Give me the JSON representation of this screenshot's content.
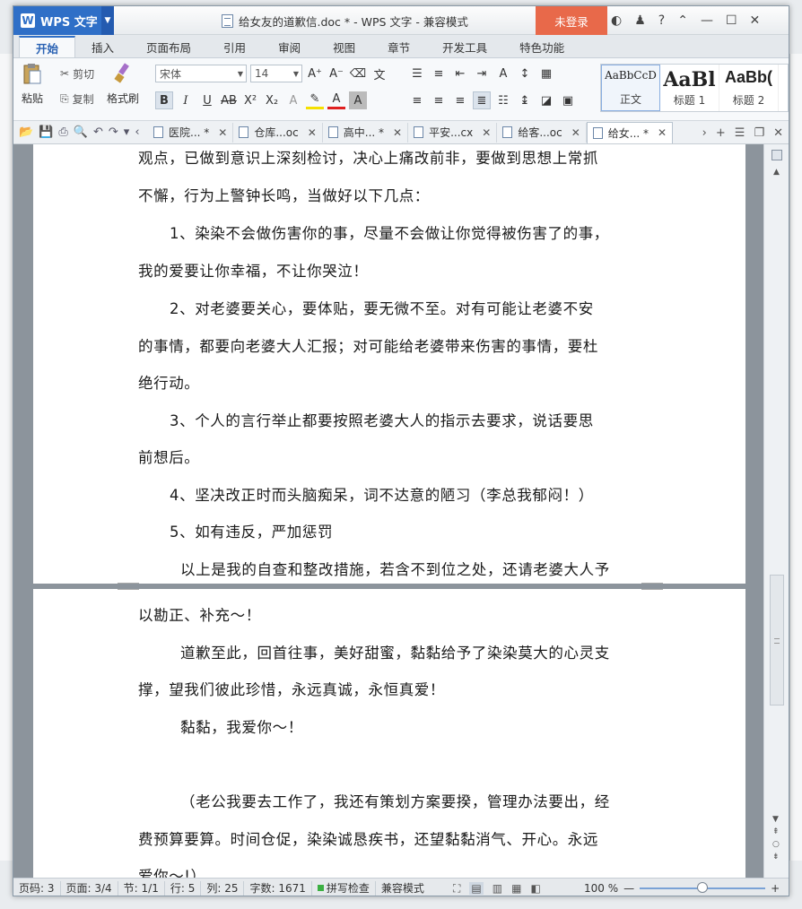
{
  "app": {
    "name": "WPS 文字",
    "logo_letter": "W"
  },
  "window": {
    "title": "给女友的道歉信.doc * - WPS 文字 - 兼容模式",
    "login": "未登录"
  },
  "ribbon_tabs": [
    "开始",
    "插入",
    "页面布局",
    "引用",
    "审阅",
    "视图",
    "章节",
    "开发工具",
    "特色功能"
  ],
  "toolbar": {
    "paste": "粘贴",
    "cut": "剪切",
    "copy": "复制",
    "format_painter": "格式刷",
    "font_name": "宋体",
    "font_size": "14"
  },
  "styles": [
    {
      "preview": "AaBbCcD",
      "label": "正文"
    },
    {
      "preview": "AaBl",
      "label": "标题 1"
    },
    {
      "preview": "AaBb(",
      "label": "标题 2"
    }
  ],
  "doc_tabs": [
    {
      "label": "医院... *"
    },
    {
      "label": "仓库...oc"
    },
    {
      "label": "高中... *"
    },
    {
      "label": "平安...cx"
    },
    {
      "label": "给客...oc"
    },
    {
      "label": "给女... *"
    }
  ],
  "document": {
    "lines": [
      "观点，已做到意识上深刻检讨，决心上痛改前非，要做到思想上常抓",
      "不懈，行为上警钟长鸣，当做好以下几点：",
      "1、染染不会做伤害你的事，尽量不会做让你觉得被伤害了的事，",
      "我的爱要让你幸福，不让你哭泣！",
      "2、对老婆要关心，要体贴，要无微不至。对有可能让老婆不安",
      "的事情，都要向老婆大人汇报；对可能给老婆带来伤害的事情，要杜",
      "绝行动。",
      "3、个人的言行举止都要按照老婆大人的指示去要求，说话要思",
      "前想后。",
      "4、坚决改正时而头脑痴呆，词不达意的陋习（李总我郁闷！）",
      "5、如有违反，严加惩罚",
      "以上是我的自查和整改措施，若含不到位之处，还请老婆大人予",
      "以勘正、补充～！",
      "道歉至此，回首往事，美好甜蜜，黏黏给予了染染莫大的心灵支",
      "撑，望我们彼此珍惜，永远真诚，永恒真爱！",
      "黏黏，我爱你～！",
      "（老公我要去工作了，我还有策划方案要揆，管理办法要出，经",
      "费预算要算。时间仓促，染染诚恳疾书，还望黏黏消气、开心。永远",
      "爱你～!）"
    ]
  },
  "statusbar": {
    "page_label": "页码: 3",
    "pages": "页面: 3/4",
    "section": "节: 1/1",
    "row": "行: 5",
    "col": "列: 25",
    "words": "字数: 1671",
    "spellcheck": "拼写检查",
    "compat": "兼容模式",
    "zoom": "100 %",
    "zoom_fraction": 0.5
  }
}
